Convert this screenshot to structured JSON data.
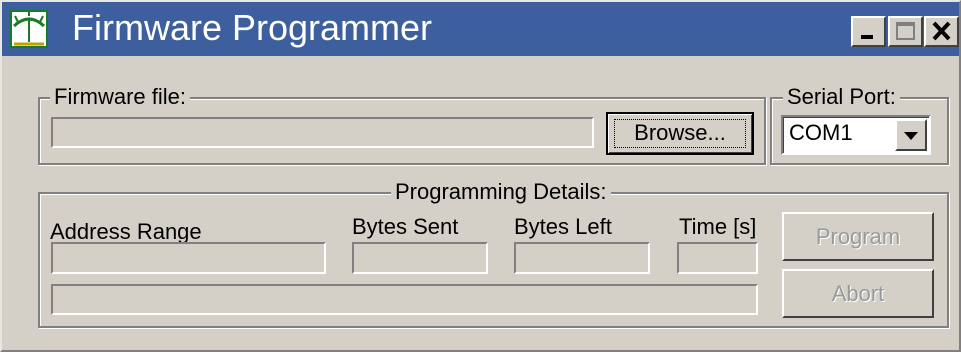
{
  "window": {
    "title": "Firmware Programmer",
    "icons": {
      "app": "antenna-icon",
      "minimize": "minimize-icon",
      "maximize": "maximize-icon",
      "close": "close-icon"
    }
  },
  "firmware": {
    "legend": "Firmware file:",
    "file_value": "",
    "browse_label": "Browse..."
  },
  "serial": {
    "legend": "Serial Port:",
    "selected": "COM1"
  },
  "details": {
    "legend": "Programming Details:",
    "address_range_label": "Address Range",
    "bytes_sent_label": "Bytes Sent",
    "bytes_left_label": "Bytes Left",
    "time_label": "Time [s]",
    "address_range_value": "",
    "bytes_sent_value": "",
    "bytes_left_value": "",
    "time_value": "",
    "progress": 0
  },
  "actions": {
    "program_label": "Program",
    "abort_label": "Abort"
  },
  "colors": {
    "titlebar": "#3d5f9e",
    "window_face": "#d4d0c8",
    "disabled_text": "#9a9a9a"
  }
}
